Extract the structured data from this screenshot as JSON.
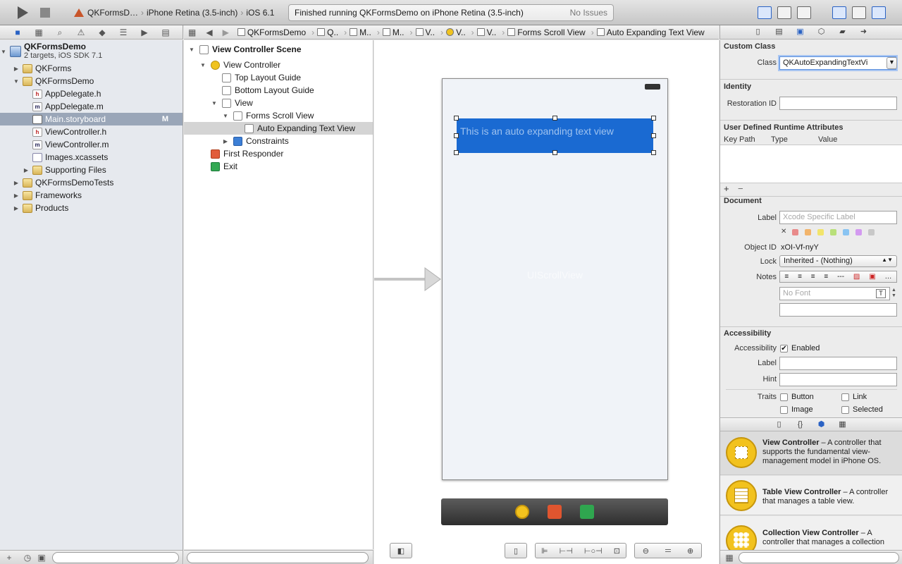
{
  "toolbar": {
    "scheme_target": "QKFormsD…",
    "scheme_device": "iPhone Retina (3.5-inch)",
    "scheme_os": "iOS 6.1",
    "status_text": "Finished running QKFormsDemo on iPhone Retina (3.5-inch)",
    "issues_text": "No Issues"
  },
  "navigator": {
    "project_name": "QKFormsDemo",
    "project_subtitle": "2 targets, iOS SDK 7.1",
    "items": [
      {
        "label": "QKForms"
      },
      {
        "label": "QKFormsDemo"
      },
      {
        "label": "AppDelegate.h"
      },
      {
        "label": "AppDelegate.m"
      },
      {
        "label": "Main.storyboard",
        "badge": "M"
      },
      {
        "label": "ViewController.h"
      },
      {
        "label": "ViewController.m"
      },
      {
        "label": "Images.xcassets"
      },
      {
        "label": "Supporting Files"
      },
      {
        "label": "QKFormsDemoTests"
      },
      {
        "label": "Frameworks"
      },
      {
        "label": "Products"
      }
    ]
  },
  "jumpbar": {
    "crumbs": [
      "QKFormsDemo",
      "Q..",
      "M..",
      "M..",
      "V..",
      "V..",
      "V..",
      "Forms Scroll View",
      "Auto Expanding Text View"
    ]
  },
  "outline": {
    "items": [
      {
        "label": "View Controller Scene"
      },
      {
        "label": "View Controller"
      },
      {
        "label": "Top Layout Guide"
      },
      {
        "label": "Bottom Layout Guide"
      },
      {
        "label": "View"
      },
      {
        "label": "Forms Scroll View"
      },
      {
        "label": "Auto Expanding Text View"
      },
      {
        "label": "Constraints"
      },
      {
        "label": "First Responder"
      },
      {
        "label": "Exit"
      }
    ]
  },
  "canvas": {
    "text_view_text": "This is an auto expanding text view",
    "scroll_view_label": "UIScrollView"
  },
  "inspector": {
    "custom_class": {
      "header": "Custom Class",
      "class_label": "Class",
      "class_value": "QKAutoExpandingTextVi"
    },
    "identity": {
      "header": "Identity",
      "restoration_label": "Restoration ID",
      "restoration_value": ""
    },
    "runtime": {
      "header": "User Defined Runtime Attributes",
      "col_key": "Key Path",
      "col_type": "Type",
      "col_value": "Value",
      "add": "+",
      "remove": "−"
    },
    "document": {
      "header": "Document",
      "label_label": "Label",
      "label_placeholder": "Xcode Specific Label",
      "clear_glyph": "✕",
      "object_id_label": "Object ID",
      "object_id_value": "xOI-Vf-nyY",
      "lock_label": "Lock",
      "lock_value": "Inherited - (Nothing)",
      "notes_label": "Notes",
      "font_placeholder": "No Font",
      "colors": [
        "#e88a8a",
        "#f2b46b",
        "#f2e46b",
        "#b9e07a",
        "#8ac4f2",
        "#d39af0",
        "#c8c8c8"
      ]
    },
    "accessibility": {
      "header": "Accessibility",
      "accessibility_label": "Accessibility",
      "enabled_label": "Enabled",
      "label_label": "Label",
      "hint_label": "Hint",
      "traits_label": "Traits",
      "trait_button": "Button",
      "trait_link": "Link",
      "trait_image": "Image",
      "trait_selected": "Selected"
    }
  },
  "library": {
    "items": [
      {
        "title": "View Controller",
        "desc": " – A controller that supports the fundamental view-management model in iPhone OS."
      },
      {
        "title": "Table View Controller",
        "desc": " – A controller that manages a table view."
      },
      {
        "title": "Collection View Controller",
        "desc": " – A controller that manages a collection"
      }
    ]
  },
  "colors": {
    "selection_blue": "#1a6ad2",
    "sidebar_selected": "#9aa6b8"
  }
}
